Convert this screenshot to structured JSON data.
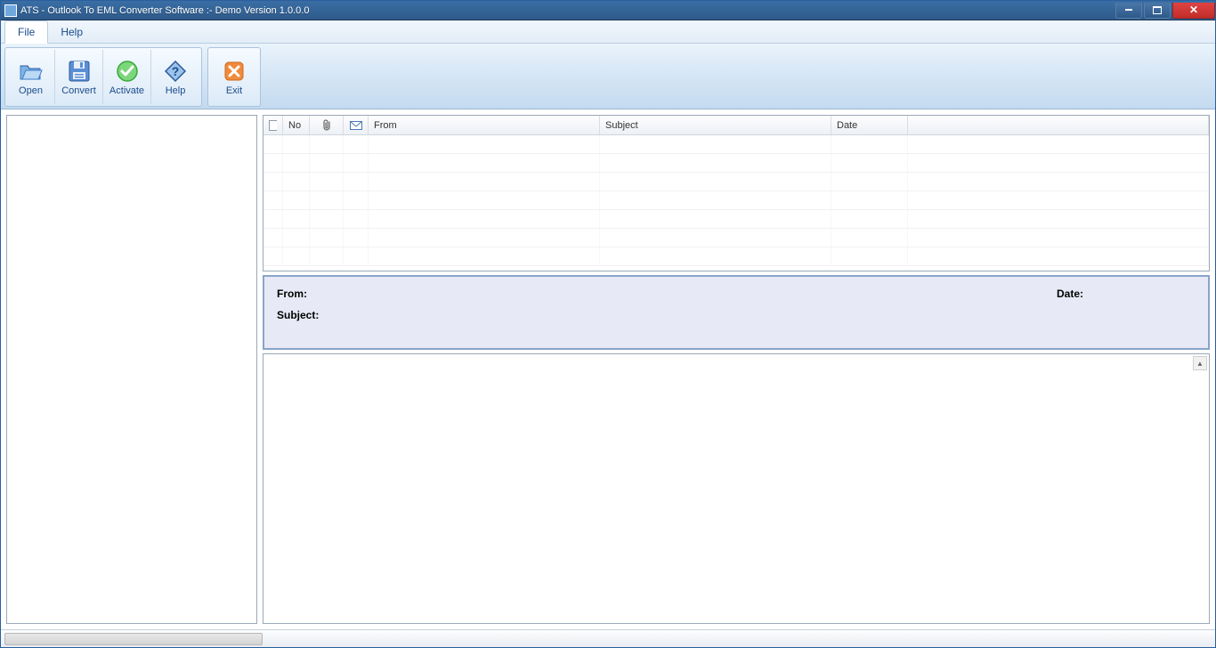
{
  "window": {
    "title": "ATS - Outlook To EML Converter Software :- Demo Version 1.0.0.0"
  },
  "menubar": {
    "file": "File",
    "help": "Help"
  },
  "toolbar": {
    "open": "Open",
    "convert": "Convert",
    "activate": "Activate",
    "help": "Help",
    "exit": "Exit"
  },
  "list": {
    "cols": {
      "no": "No",
      "from": "From",
      "subject": "Subject",
      "date": "Date"
    }
  },
  "preview": {
    "from_label": "From:",
    "date_label": "Date:",
    "subject_label": "Subject:"
  }
}
